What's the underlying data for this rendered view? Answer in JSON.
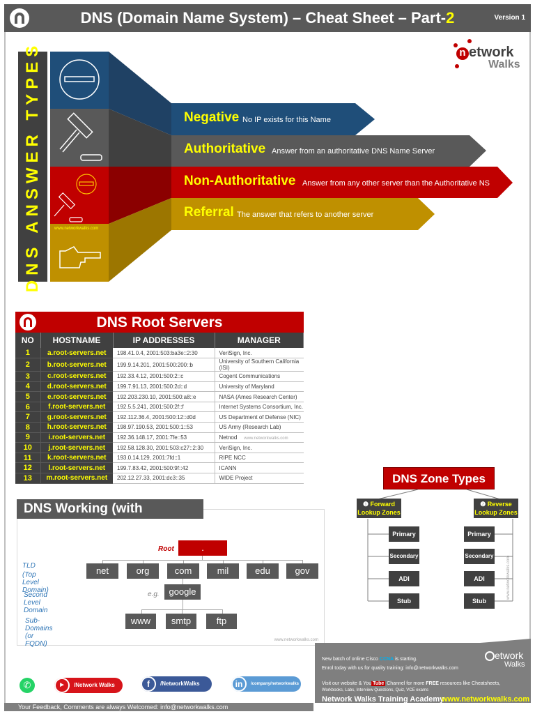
{
  "header": {
    "title_main": "DNS (Domain Name System) – Cheat Sheet – Part-",
    "title_part": "2",
    "version": "Version 1"
  },
  "brand": {
    "logo_letter": "n",
    "logo_word": "etwork",
    "logo_sub": "Walks"
  },
  "answer_types": {
    "vertical_title": "DNS ANSWER TYPES",
    "watermark": "www.networkwalks.com",
    "items": [
      {
        "title": "Negative",
        "description": "No IP exists for this Name",
        "color": "#1f4e79",
        "icon": "minus-circle-icon"
      },
      {
        "title": "Authoritative",
        "description": "Answer from an authoritative DNS Name Server",
        "color": "#595959",
        "icon": "gavel-icon"
      },
      {
        "title": "Non-Authoritative",
        "description": "Answer from any other server than the Authoritative NS",
        "color": "#c00000",
        "icon": "gavel-minus-icon"
      },
      {
        "title": "Referral",
        "description": "The answer that refers to another server",
        "color": "#bf9000",
        "icon": "pointing-hand-icon"
      }
    ]
  },
  "root_servers": {
    "title": "DNS Root Servers",
    "columns": [
      "NO",
      "HOSTNAME",
      "IP ADDRESSES",
      "MANAGER"
    ],
    "watermark": "www.networkwalks.com",
    "rows": [
      {
        "no": "1",
        "host": "a.root-servers.net",
        "ip": "198.41.0.4, 2001:503:ba3e::2:30",
        "manager": "VeriSign, Inc."
      },
      {
        "no": "2",
        "host": "b.root-servers.net",
        "ip": "199.9.14.201, 2001:500:200::b",
        "manager": "University of Southern California (ISI)"
      },
      {
        "no": "3",
        "host": "c.root-servers.net",
        "ip": "192.33.4.12, 2001:500:2::c",
        "manager": "Cogent Communications"
      },
      {
        "no": "4",
        "host": "d.root-servers.net",
        "ip": "199.7.91.13, 2001:500:2d::d",
        "manager": "University of Maryland"
      },
      {
        "no": "5",
        "host": "e.root-servers.net",
        "ip": "192.203.230.10, 2001:500:a8::e",
        "manager": "NASA (Ames Research Center)"
      },
      {
        "no": "6",
        "host": "f.root-servers.net",
        "ip": "192.5.5.241, 2001:500:2f::f",
        "manager": "Internet Systems Consortium, Inc."
      },
      {
        "no": "7",
        "host": "g.root-servers.net",
        "ip": "192.112.36.4, 2001:500:12::d0d",
        "manager": "US Department of Defense (NIC)"
      },
      {
        "no": "8",
        "host": "h.root-servers.net",
        "ip": "198.97.190.53, 2001:500:1::53",
        "manager": "US Army (Research Lab)"
      },
      {
        "no": "9",
        "host": "i.root-servers.net",
        "ip": "192.36.148.17, 2001:7fe::53",
        "manager": "Netnod"
      },
      {
        "no": "10",
        "host": "j.root-servers.net",
        "ip": "192.58.128.30, 2001:503:c27::2:30",
        "manager": "VeriSign, Inc."
      },
      {
        "no": "11",
        "host": "k.root-servers.net",
        "ip": "193.0.14.129, 2001:7fd::1",
        "manager": "RIPE NCC"
      },
      {
        "no": "12",
        "host": "l.root-servers.net",
        "ip": "199.7.83.42, 2001:500:9f::42",
        "manager": "ICANN"
      },
      {
        "no": "13",
        "host": "m.root-servers.net",
        "ip": "202.12.27.33, 2001:dc3::35",
        "manager": "WIDE Project"
      }
    ]
  },
  "dns_working": {
    "title": "DNS Working (with example)",
    "root_label": "Root",
    "root_node": ".",
    "tld_label_1": "TLD",
    "tld_label_2": "(Top Level Domain)",
    "tlds": [
      "net",
      "org",
      "com",
      "mil",
      "edu",
      "gov"
    ],
    "sld_label": "Second Level Domain",
    "eg": "e.g.",
    "sld": "google",
    "sub_label": "Sub-Domains (or FQDN)",
    "subs": [
      "www",
      "smtp",
      "ftp"
    ],
    "watermark": "www.networkwalks.com"
  },
  "zone_types": {
    "title": "DNS Zone Types",
    "forward": {
      "num": "❶",
      "label_1": "Forward",
      "label_2": "Lookup Zones"
    },
    "reverse": {
      "num": "❷",
      "label_1": "Reverse",
      "label_2": "Lookup Zones"
    },
    "items": [
      "Primary",
      "Secondary",
      "ADI",
      "Stub"
    ],
    "watermark": "www.networkwalks.com"
  },
  "footer": {
    "line1_a": "New batch of online Cisco ",
    "line1_ccna": "CCNA",
    "line1_b": " is starting.",
    "line2": "Enrol today with us for quality training: info@networkwalks.com",
    "line3_a": "Visit our website & You",
    "line3_tube": "Tube",
    "line3_b": " Channel for more ",
    "line3_free": "FREE",
    "line3_c": " resources like Cheatsheets,",
    "line4": "Workbooks, Labs, Interview Questions, Quiz, VCE exams",
    "academy": "Network Walks Training Academy",
    "website": "www.networkwalks.com",
    "feedback": "Your Feedback, Comments are always Welcomed: info@networkwalks.com",
    "social": {
      "youtube": "/Network Walks",
      "facebook": "/NetworkWalks",
      "linkedin": "/company/networkwalks"
    }
  }
}
